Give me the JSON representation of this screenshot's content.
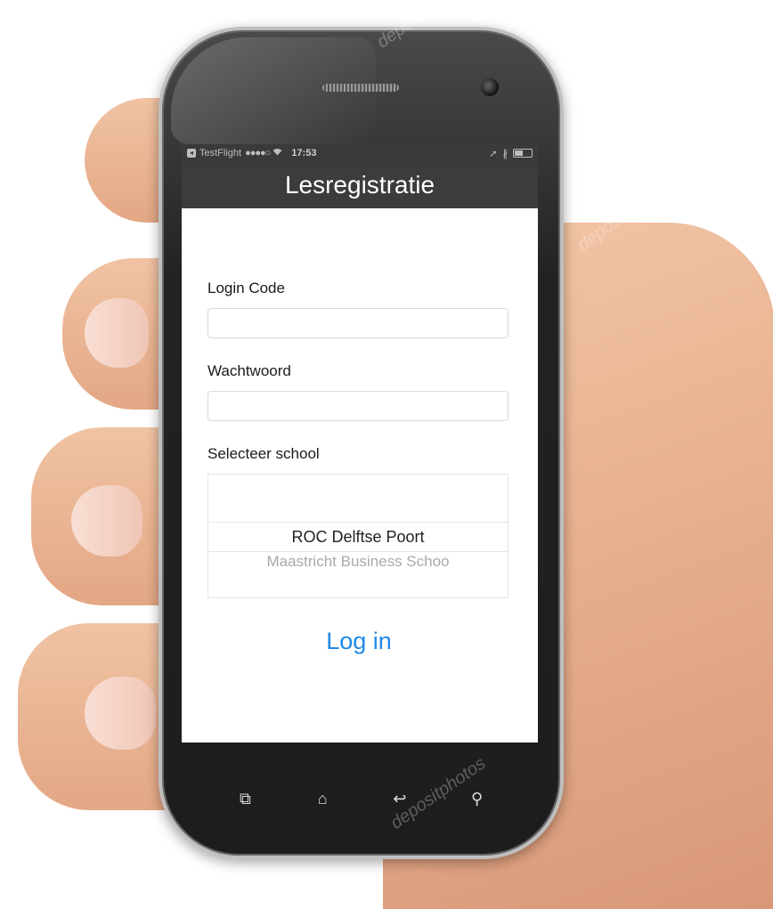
{
  "statusbar": {
    "app_name": "TestFlight",
    "signal": "●●●●○",
    "time": "17:53"
  },
  "app": {
    "title": "Lesregistratie"
  },
  "form": {
    "login_code_label": "Login Code",
    "login_code_value": "",
    "password_label": "Wachtwoord",
    "password_value": "",
    "school_label": "Selecteer school",
    "school_selected": "ROC Delftse Poort",
    "school_next": "Maastricht Business Schoo",
    "login_button": "Log in"
  },
  "watermarks": {
    "top": "deposit",
    "middle": "depositphotos",
    "bottom": "depositphotos"
  },
  "icons": {
    "hw_left": "recent-apps-icon",
    "hw_home": "home-icon",
    "hw_back": "back-icon",
    "hw_search": "search-icon"
  },
  "colors": {
    "navbar": "#3c3c3c",
    "accent": "#1f88e8"
  }
}
